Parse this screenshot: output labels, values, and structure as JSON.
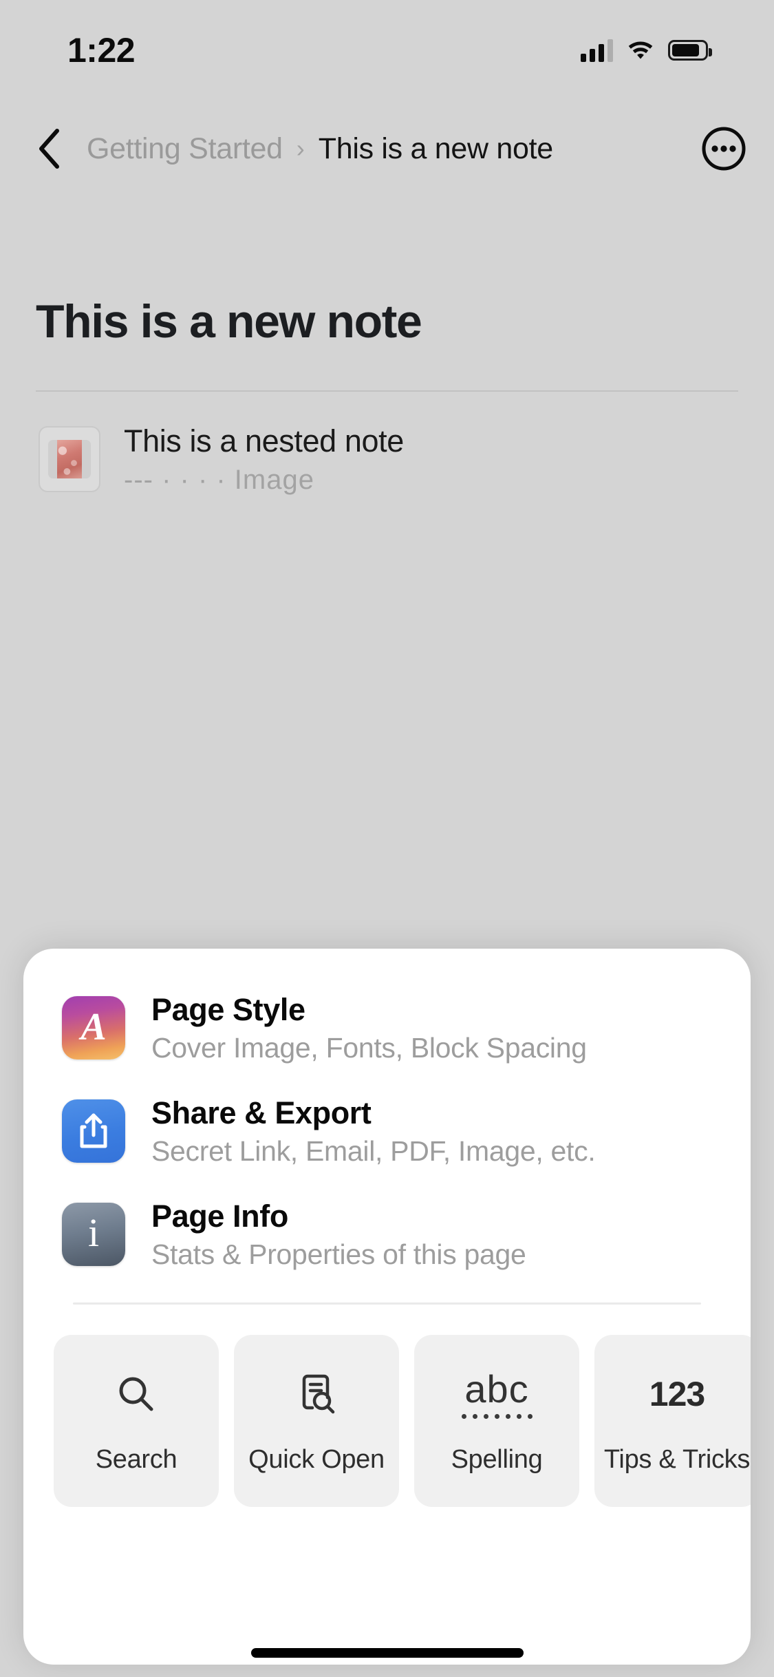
{
  "status_bar": {
    "time": "1:22",
    "icons": [
      "cellular-signal-icon",
      "wifi-icon",
      "battery-icon"
    ]
  },
  "navbar": {
    "back_icon": "chevron-left-icon",
    "breadcrumb": {
      "parent": "Getting Started",
      "separator": "›",
      "current": "This is a new note"
    },
    "more_icon": "more-ellipsis-circle-icon"
  },
  "document": {
    "title": "This is a new note",
    "nested_note": {
      "title": "This is a nested note",
      "subtitle": "--- · · · · Image",
      "thumbnail": "image-thumbnail"
    }
  },
  "sheet": {
    "menu_items": [
      {
        "title": "Page Style",
        "subtitle": "Cover Image, Fonts, Block Spacing",
        "icon": "page-style-icon",
        "glyph": "A",
        "color": "#c0569a"
      },
      {
        "title": "Share & Export",
        "subtitle": "Secret Link, Email, PDF, Image, etc.",
        "icon": "share-export-icon",
        "glyph": "share-arrow",
        "color": "#3b7de0"
      },
      {
        "title": "Page Info",
        "subtitle": "Stats & Properties of this page",
        "icon": "page-info-icon",
        "glyph": "i",
        "color": "#6f7d8e"
      }
    ],
    "tiles": [
      {
        "label": "Search",
        "icon": "search-icon"
      },
      {
        "label": "Quick Open",
        "icon": "quick-open-icon"
      },
      {
        "label": "Spelling",
        "icon": "spelling-abc-icon",
        "glyph": "abc"
      },
      {
        "label": "Tips &\nTricks",
        "icon": "tips-tricks-icon",
        "glyph": "123"
      }
    ]
  },
  "home_indicator": "home-indicator-bar"
}
